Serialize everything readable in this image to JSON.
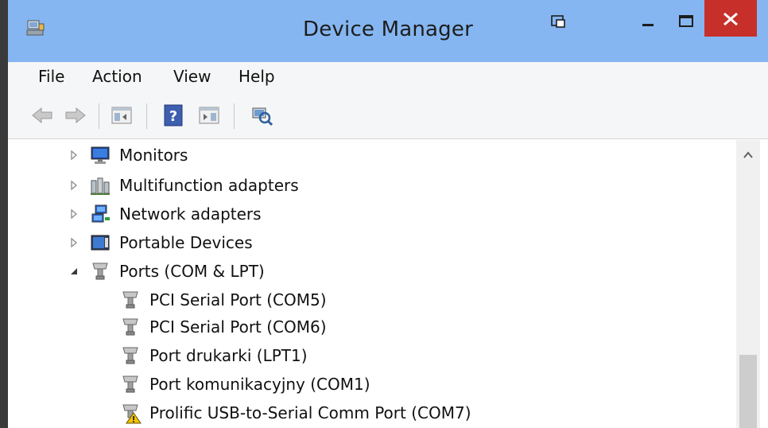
{
  "window": {
    "title": "Device Manager"
  },
  "menu": {
    "items": [
      {
        "label": "File"
      },
      {
        "label": "Action"
      },
      {
        "label": "View"
      },
      {
        "label": "Help"
      }
    ]
  },
  "toolbar": {
    "buttons": [
      "back-icon",
      "forward-icon",
      "show-hide-console-tree-icon",
      "help-icon",
      "show-hide-action-pane-icon",
      "scan-hardware-icon"
    ]
  },
  "tree": {
    "categories": [
      {
        "label": "Monitors",
        "icon": "monitor-icon",
        "expanded": false
      },
      {
        "label": "Multifunction adapters",
        "icon": "multifunction-adapter-icon",
        "expanded": false
      },
      {
        "label": "Network adapters",
        "icon": "network-adapter-icon",
        "expanded": false
      },
      {
        "label": "Portable Devices",
        "icon": "portable-device-icon",
        "expanded": false
      },
      {
        "label": "Ports (COM & LPT)",
        "icon": "port-icon",
        "expanded": true
      }
    ],
    "ports": [
      {
        "label": "PCI Serial Port (COM5)",
        "icon": "port-icon",
        "warning": false
      },
      {
        "label": "PCI Serial Port (COM6)",
        "icon": "port-icon",
        "warning": false
      },
      {
        "label": "Port drukarki (LPT1)",
        "icon": "port-icon",
        "warning": false
      },
      {
        "label": "Port komunikacyjny (COM1)",
        "icon": "port-icon",
        "warning": false
      },
      {
        "label": "Prolific USB-to-Serial Comm Port (COM7)",
        "icon": "port-warning-icon",
        "warning": true
      }
    ]
  },
  "colors": {
    "titlebar": "#85b6f1",
    "close": "#c7302a",
    "warning": "#f2c200"
  }
}
